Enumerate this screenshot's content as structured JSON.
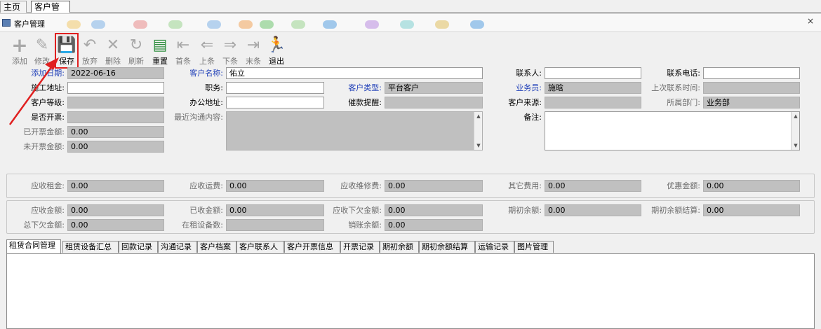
{
  "outer_tabs": [
    {
      "label": "主页"
    },
    {
      "label": "客户管理"
    }
  ],
  "window": {
    "title": "客户管理",
    "close": "×"
  },
  "toolbar": {
    "add": "添加",
    "edit": "修改",
    "save": "保存",
    "discard": "放弃",
    "delete": "删除",
    "refresh": "刷新",
    "reset": "重置",
    "first": "首条",
    "prev": "上条",
    "next": "下条",
    "last": "末条",
    "exit": "退出"
  },
  "icons": {
    "add": "+",
    "edit": "✎",
    "save": "💾",
    "discard": "↶",
    "delete": "✕",
    "refresh": "↻",
    "reset": "▤",
    "first": "⇤",
    "prev": "⇐",
    "next": "⇒",
    "last": "⇥",
    "exit": "🏃"
  },
  "form": {
    "add_date": {
      "label": "添加日期:",
      "value": "2022-06-16"
    },
    "customer_name": {
      "label": "客户名称:",
      "value": "佑立"
    },
    "contact_person": {
      "label": "联系人:",
      "value": ""
    },
    "contact_phone": {
      "label": "联系电话:",
      "value": ""
    },
    "construction_address": {
      "label": "施工地址:",
      "value": ""
    },
    "position": {
      "label": "职务:",
      "value": ""
    },
    "customer_type": {
      "label": "客户类型:",
      "value": "平台客户"
    },
    "salesperson": {
      "label": "业务员:",
      "value": "施晗"
    },
    "last_contact_time": {
      "label": "上次联系时间:",
      "value": ""
    },
    "customer_level": {
      "label": "客户等级:",
      "value": ""
    },
    "office_address": {
      "label": "办公地址:",
      "value": ""
    },
    "payment_reminder": {
      "label": "催款提醒:",
      "value": ""
    },
    "customer_source": {
      "label": "客户来源:",
      "value": ""
    },
    "department": {
      "label": "所属部门:",
      "value": "业务部"
    },
    "invoiced": {
      "label": "是否开票:",
      "value": ""
    },
    "recent_contact": {
      "label": "最近沟通内容:",
      "value": ""
    },
    "remarks": {
      "label": "备注:",
      "value": ""
    },
    "invoiced_amount": {
      "label": "已开票金额:",
      "value": "0.00"
    },
    "uninvoiced_amount": {
      "label": "未开票金额:",
      "value": "0.00"
    }
  },
  "fees": {
    "rent": {
      "label": "应收租金:",
      "value": "0.00"
    },
    "freight": {
      "label": "应收运费:",
      "value": "0.00"
    },
    "repair": {
      "label": "应收维修费:",
      "value": "0.00"
    },
    "other": {
      "label": "其它费用:",
      "value": "0.00"
    },
    "discount": {
      "label": "优惠金额:",
      "value": "0.00"
    }
  },
  "summary": {
    "receivable": {
      "label": "应收金额:",
      "value": "0.00"
    },
    "received": {
      "label": "已收金额:",
      "value": "0.00"
    },
    "outstanding": {
      "label": "应收下欠金额:",
      "value": "0.00"
    },
    "opening_balance": {
      "label": "期初余额:",
      "value": "0.00"
    },
    "opening_settlement": {
      "label": "期初余额结算:",
      "value": "0.00"
    },
    "total_outstanding": {
      "label": "总下欠金额:",
      "value": "0.00"
    },
    "renting_count": {
      "label": "在租设备数:",
      "value": ""
    },
    "writeoff_balance": {
      "label": "销账余额:",
      "value": "0.00"
    }
  },
  "bottom_tabs": [
    {
      "label": "租赁合同管理"
    },
    {
      "label": "租赁设备汇总"
    },
    {
      "label": "回款记录"
    },
    {
      "label": "沟通记录"
    },
    {
      "label": "客户档案"
    },
    {
      "label": "客户联系人"
    },
    {
      "label": "客户开票信息"
    },
    {
      "label": "开票记录"
    },
    {
      "label": "期初余额"
    },
    {
      "label": "期初余额结算"
    },
    {
      "label": "运输记录"
    },
    {
      "label": "图片管理"
    }
  ],
  "colors": {
    "highlight_red": "#e02020",
    "label_blue": "#1f3fb8",
    "readonly_gray": "#c0c0c0"
  }
}
